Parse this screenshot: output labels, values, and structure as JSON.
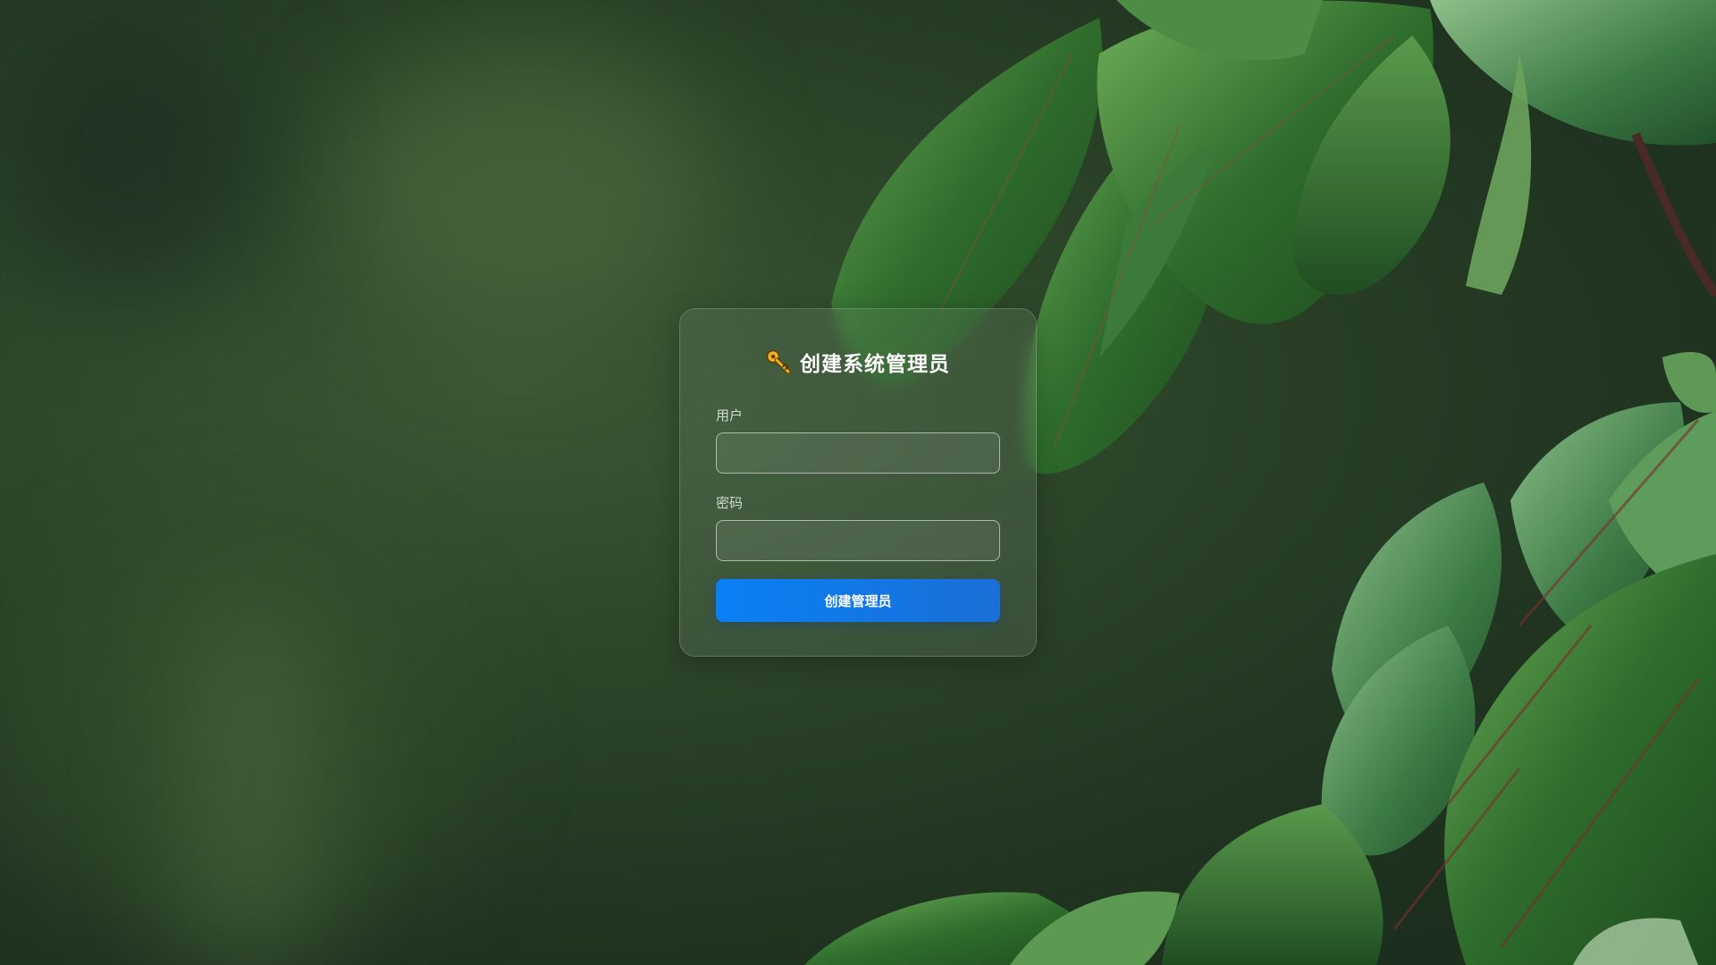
{
  "login_card": {
    "title": "创建系统管理员",
    "title_icon": "key-icon",
    "username_label": "用户",
    "username_value": "",
    "password_label": "密码",
    "password_value": "",
    "submit_label": "创建管理员"
  },
  "colors": {
    "accent": "#0a80f5",
    "background": "#2a4227",
    "leaf": "#3f7a3a"
  }
}
